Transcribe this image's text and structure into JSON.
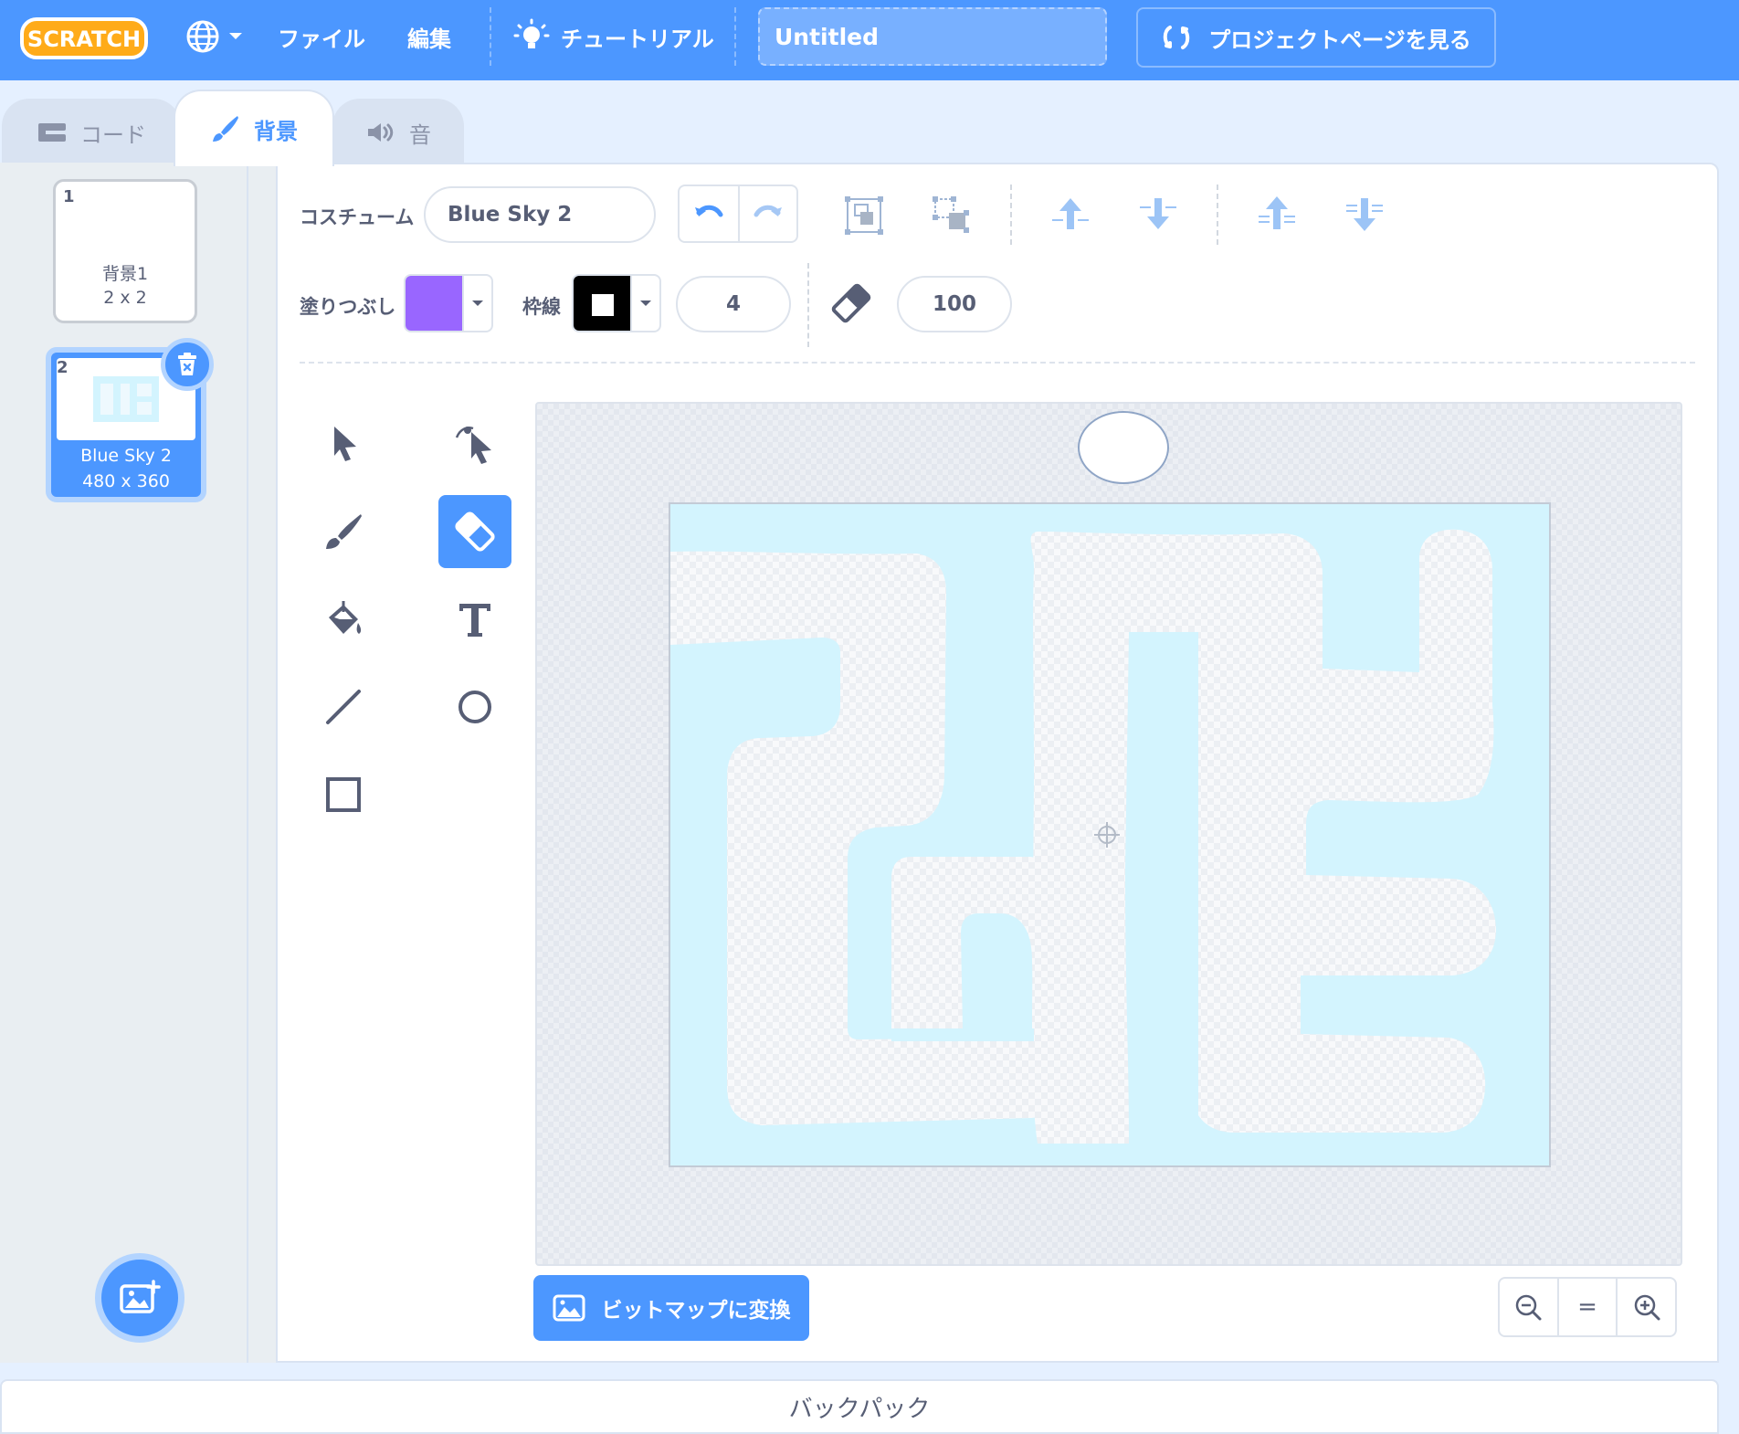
{
  "menubar": {
    "logo_text": "SCRATCH",
    "file_label": "ファイル",
    "edit_label": "編集",
    "tutorials_label": "チュートリアル",
    "project_title": "Untitled",
    "project_page_label": "プロジェクトページを見る"
  },
  "tabs": [
    {
      "label": "コード",
      "icon": "code-blocks-icon"
    },
    {
      "label": "背景",
      "icon": "paintbrush-icon"
    },
    {
      "label": "音",
      "icon": "speaker-icon"
    }
  ],
  "costumes": [
    {
      "number": "1",
      "name": "背景1",
      "size": "2 x 2",
      "selected": false
    },
    {
      "number": "2",
      "name": "Blue Sky 2",
      "size": "480 x 360",
      "selected": true
    }
  ],
  "editor": {
    "costume_label": "コスチューム",
    "costume_name": "Blue Sky 2",
    "fill_label": "塗りつぶし",
    "fill_color": "#9966ff",
    "outline_label": "枠線",
    "outline_color": "#000000",
    "outline_width": "4",
    "eraser_size": "100",
    "selected_tool": "eraser",
    "convert_label": "ビットマップに変換",
    "zoom_reset_label": "="
  },
  "colors": {
    "accent": "#4c97ff",
    "canvas_fill": "#d3f4fe"
  },
  "backpack_label": "バックパック"
}
